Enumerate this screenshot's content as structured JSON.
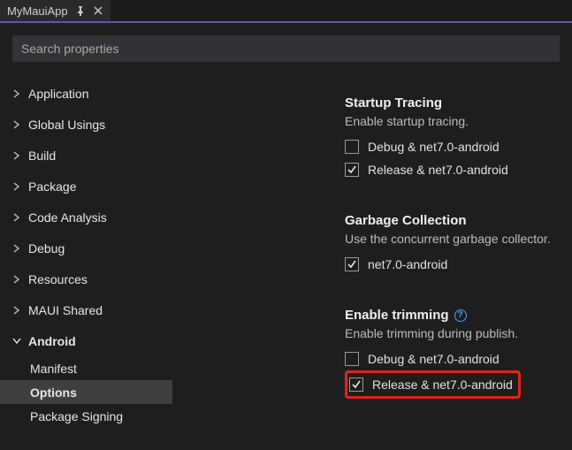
{
  "tab": {
    "title": "MyMauiApp"
  },
  "search": {
    "placeholder": "Search properties"
  },
  "tree": {
    "items": [
      {
        "label": "Application"
      },
      {
        "label": "Global Usings"
      },
      {
        "label": "Build"
      },
      {
        "label": "Package"
      },
      {
        "label": "Code Analysis"
      },
      {
        "label": "Debug"
      },
      {
        "label": "Resources"
      },
      {
        "label": "MAUI Shared"
      }
    ],
    "android": {
      "label": "Android",
      "children": [
        {
          "label": "Manifest"
        },
        {
          "label": "Options"
        },
        {
          "label": "Package Signing"
        }
      ]
    }
  },
  "sections": {
    "startup": {
      "title": "Startup Tracing",
      "desc": "Enable startup tracing.",
      "opts": [
        {
          "label": "Debug & net7.0-android",
          "checked": false
        },
        {
          "label": "Release & net7.0-android",
          "checked": true
        }
      ]
    },
    "gc": {
      "title": "Garbage Collection",
      "desc": "Use the concurrent garbage collector.",
      "opts": [
        {
          "label": "net7.0-android",
          "checked": true
        }
      ]
    },
    "trim": {
      "title": "Enable trimming",
      "desc": "Enable trimming during publish.",
      "opts": [
        {
          "label": "Debug & net7.0-android",
          "checked": false
        },
        {
          "label": "Release & net7.0-android",
          "checked": true
        }
      ]
    }
  }
}
